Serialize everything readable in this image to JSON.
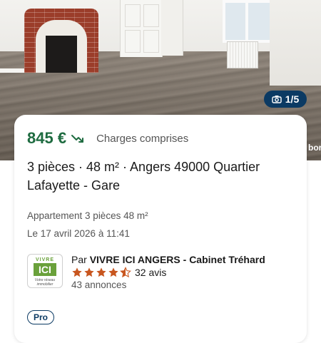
{
  "photo": {
    "counter": "1/5",
    "icon": "camera-icon"
  },
  "listing": {
    "price": "845 €",
    "price_trend_icon": "trend-down-icon",
    "charges": "Charges comprises",
    "title": "3 pièces · 48 m² · Angers 49000 Quartier Lafayette - Gare",
    "type_line": "Appartement 3 pièces 48 m²",
    "date_line": "Le 17 avril 2026 à 11:41"
  },
  "agency": {
    "logo_top": "VIVRE",
    "logo_mid": "ICI",
    "logo_bottom": "Votre réseau immobilier",
    "by_prefix": "Par",
    "name": "VIVRE ICI ANGERS - Cabinet Tréhard",
    "rating": 4.5,
    "reviews": "32 avis",
    "listings": "43 annonces",
    "badge": "Pro"
  },
  "next_card_peek": "bor",
  "colors": {
    "price": "#1e6b40",
    "badge_bg": "#0b3a63",
    "star": "#c8561f",
    "logo_green": "#6aa13b"
  }
}
